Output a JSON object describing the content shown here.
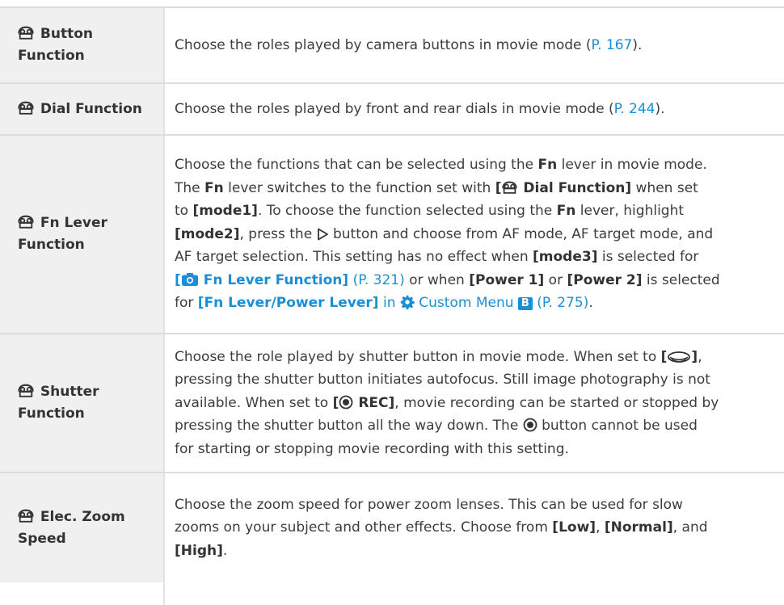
{
  "rows": [
    {
      "name_line1": "Button",
      "name_line2": "Function",
      "desc": "Choose the roles played by camera buttons in movie mode (",
      "ref": "P. 167",
      "desc_end": ")."
    },
    {
      "name": "Dial Function",
      "desc": "Choose the roles played by front and rear dials in movie mode (",
      "ref": "P. 244",
      "desc_end": ")."
    },
    {
      "name_line1": "Fn Lever",
      "name_line2": "Function",
      "t1": "Choose the functions that can be selected using the ",
      "fn": "Fn",
      "t2": " lever in movie mode.",
      "t3": "The ",
      "t4": " lever switches to the function set with ",
      "dial_fn_open": "[",
      "dial_fn_label": "Dial Function]",
      "t5": " when set",
      "t6": "to ",
      "mode1": "[mode1]",
      "t7": ". To choose the function selected using the ",
      "t8": " lever, highlight",
      "mode2": "[mode2]",
      "t9": ", press the ",
      "t10": " button and choose from AF mode, AF target mode, and",
      "t11": "AF target selection. This setting has no effect when ",
      "mode3": "[mode3]",
      "t12": " is selected for",
      "photo_fn_open": "[",
      "photo_fn_label": "Fn Lever Function]",
      "ref1": "(P. 321)",
      "t13": " or when ",
      "power1": "[Power 1]",
      "t14": " or ",
      "power2": "[Power 2]",
      "t15": " is selected",
      "t16": "for ",
      "fn_power": "[Fn Lever/Power Lever]",
      "in": " in ",
      "custom_menu": "Custom Menu",
      "menu_b": "B",
      "ref2": "(P. 275)",
      "t17": "."
    },
    {
      "name_line1": "Shutter",
      "name_line2": "Function",
      "s1": "Choose the role played by shutter button in movie mode. When set to ",
      "s_af_open": "[",
      "s_af_close": "]",
      "s2": ",",
      "s3": "pressing the shutter button initiates autofocus. Still image photography is not",
      "s4": "available. When set to ",
      "s_rec_open": "[",
      "s_rec_label": "REC]",
      "s5": ", movie recording can be started or stopped by",
      "s6": "pressing the shutter button all the way down. The ",
      "s7": " button cannot be used",
      "s8": "for starting or stopping movie recording with this setting."
    },
    {
      "name_line1": "Elec. Zoom",
      "name_line2": "Speed",
      "z1": "Choose the zoom speed for power zoom lenses. This can be used for slow",
      "z2": "zooms on your subject and other effects. Choose from ",
      "low": "[Low]",
      "comma": ", ",
      "normal": "[Normal]",
      "and": ", and",
      "high": "[High]",
      "period": "."
    }
  ],
  "colors": {
    "link": "#1a8fd6",
    "left_bg": "#f0f0f0",
    "rule": "#dcdcdc"
  },
  "icons": {
    "movie": "movie-mode-icon",
    "camera": "camera-icon",
    "gear": "gear-icon",
    "af": "af-target-icon",
    "rec": "rec-button-icon",
    "play": "right-arrow-icon"
  }
}
